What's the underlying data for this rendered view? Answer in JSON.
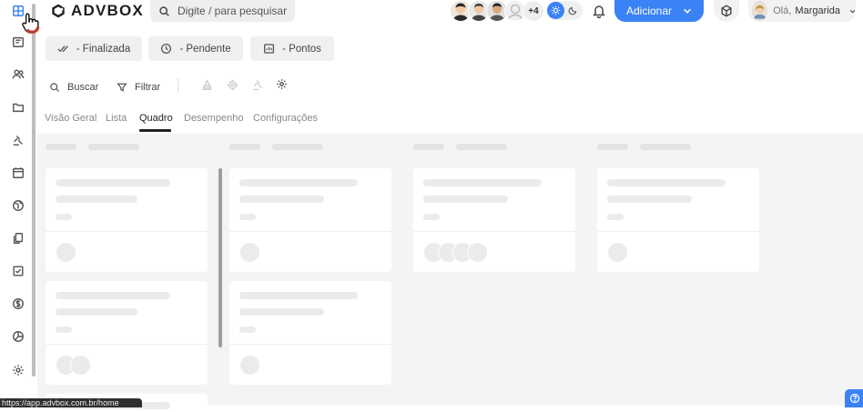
{
  "header": {
    "logo_text": "ADVBOX",
    "search_placeholder": "Digite / para pesquisar",
    "avatars_more": "+4",
    "add_button": "Adicionar",
    "greeting_hello": "Olá,",
    "greeting_name": "Margarida"
  },
  "status_pills": [
    {
      "label": "- Finalizada",
      "icon": "double-check-icon"
    },
    {
      "label": "- Pendente",
      "icon": "clock-icon"
    },
    {
      "label": "- Pontos",
      "icon": "points-icon"
    }
  ],
  "toolbar": {
    "search_label": "Buscar",
    "filter_label": "Filtrar"
  },
  "tabs": [
    {
      "label": "Visão Geral",
      "active": false
    },
    {
      "label": "Lista",
      "active": false
    },
    {
      "label": "Quadro",
      "active": true
    },
    {
      "label": "Desempenho",
      "active": false
    },
    {
      "label": "Configurações",
      "active": false
    }
  ],
  "sidebar": {
    "items": [
      "dashboard-icon",
      "calendar-board-icon",
      "users-icon",
      "folder-icon",
      "gavel-icon",
      "calendar-icon",
      "globe-icon",
      "documents-icon",
      "checkbox-icon",
      "dollar-icon",
      "pie-chart-icon",
      "settings-icon"
    ]
  },
  "status_bar": {
    "url": "https://app.advbox.com.br/home"
  },
  "colors": {
    "accent": "#3b82f6",
    "board_bg": "#f3f4f4",
    "skeleton": "#ebebeb"
  }
}
